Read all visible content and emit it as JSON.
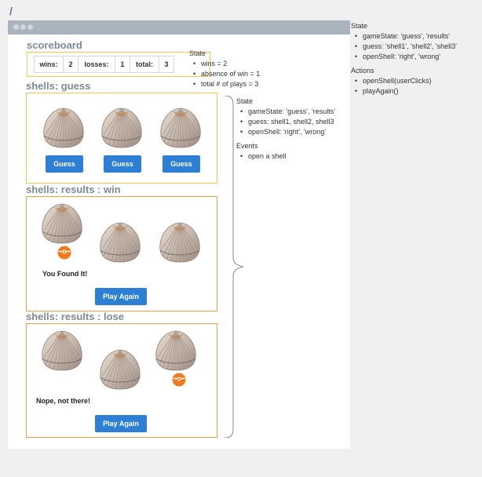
{
  "page": {
    "route": "/"
  },
  "scoreboard": {
    "title": "scoreboard",
    "cells": [
      {
        "label": "wins:",
        "value": "2"
      },
      {
        "label": "losses:",
        "value": "1"
      },
      {
        "label": "total:",
        "value": "3"
      }
    ],
    "notes": {
      "heading": "State",
      "items": [
        "wins = 2",
        "absence of win = 1",
        "total # of plays = 3"
      ]
    }
  },
  "guess_section": {
    "title": "shells: guess",
    "button_label": "Guess"
  },
  "win_section": {
    "title": "shells: results : win",
    "message": "You Found It!",
    "button_label": "Play Again"
  },
  "lose_section": {
    "title": "shells: results : lose",
    "message": "Nope, not there!",
    "button_label": "Play Again"
  },
  "shells_notes": {
    "state_heading": "State",
    "state_items": [
      "gameState: 'guess', 'results'",
      "guess: shell1, shell2, shell3",
      "openShell: 'right', 'wrong'"
    ],
    "events_heading": "Events",
    "events_items": [
      "open a shell"
    ]
  },
  "app_notes": {
    "state_heading": "State",
    "state_items": [
      "gameState: 'guess', 'results'",
      "guess: 'shell1', 'shell2', 'shell3'",
      "openShell: 'right', 'wrong'"
    ],
    "actions_heading": "Actions",
    "actions_items": [
      "openShell(userClicks)",
      "playAgain()"
    ]
  },
  "colors": {
    "accent_blue": "#2d7fd6",
    "scoreboard_border": "#f2c94c",
    "results_border": "#f0a04b",
    "token_orange": "#f07b1d"
  },
  "icons": {
    "shell": "seashell-icon",
    "token": "ball-token-icon"
  }
}
